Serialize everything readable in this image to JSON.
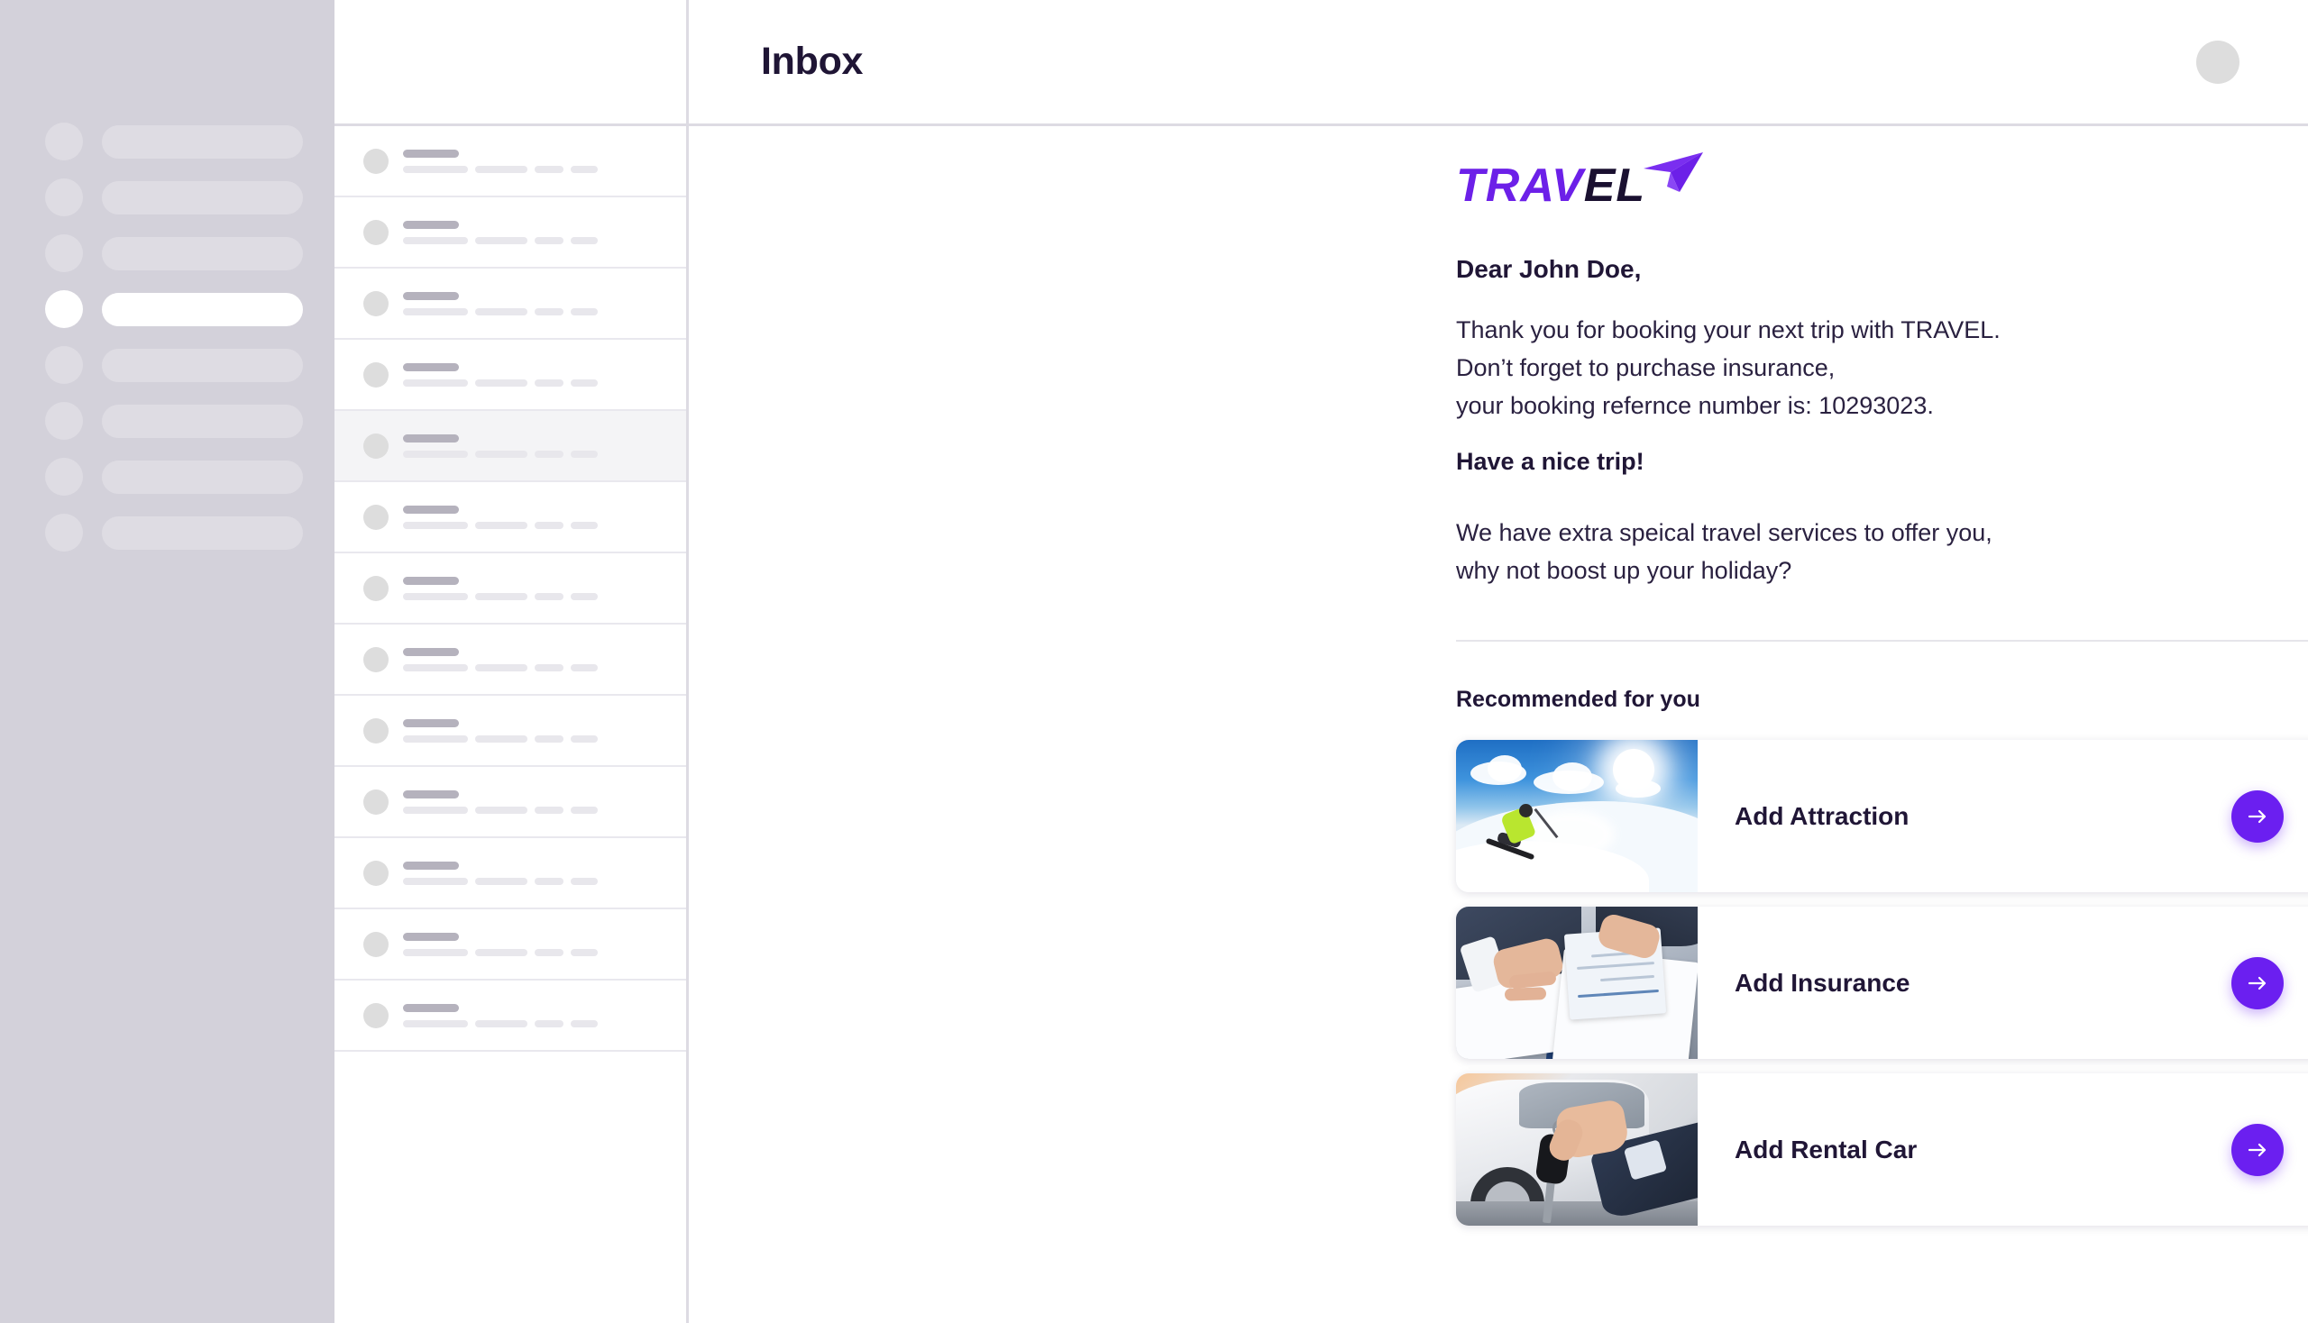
{
  "header": {
    "title": "Inbox",
    "avatar_icon": "user-avatar-placeholder"
  },
  "nav_rail": {
    "items": [
      {
        "state": "default"
      },
      {
        "state": "default"
      },
      {
        "state": "default"
      },
      {
        "state": "active"
      },
      {
        "state": "default"
      },
      {
        "state": "default"
      },
      {
        "state": "default"
      },
      {
        "state": "default"
      }
    ]
  },
  "message_list": {
    "rows": [
      {
        "selected": false
      },
      {
        "selected": false
      },
      {
        "selected": false
      },
      {
        "selected": false
      },
      {
        "selected": true
      },
      {
        "selected": false
      },
      {
        "selected": false
      },
      {
        "selected": false
      },
      {
        "selected": false
      },
      {
        "selected": false
      },
      {
        "selected": false
      },
      {
        "selected": false
      },
      {
        "selected": false
      }
    ]
  },
  "email": {
    "brand": {
      "name_primary": "TRAV",
      "name_secondary": "EL",
      "primary_color": "#6c20e8",
      "secondary_color": "#1a1030",
      "plane_icon": "paper-plane-icon"
    },
    "greeting": "Dear John Doe,",
    "paragraph_1": {
      "line_1": "Thank you for booking your next trip with TRAVEL.",
      "line_2": "Don’t forget to purchase insurance,",
      "line_3": "your booking refernce number is: 10293023."
    },
    "closing": "Have a nice trip!",
    "paragraph_2": {
      "line_1": "We have extra speical travel services to offer you,",
      "line_2": "why not boost up your holiday?"
    },
    "recommended_heading": "Recommended for you",
    "recommendations": [
      {
        "label": "Add Attraction",
        "thumb_icon": "ski-slope-photo",
        "cta_icon": "arrow-right-icon"
      },
      {
        "label": "Add Insurance",
        "thumb_icon": "insurance-paperwork-photo",
        "cta_icon": "arrow-right-icon"
      },
      {
        "label": "Add Rental Car",
        "thumb_icon": "car-keys-photo",
        "cta_icon": "arrow-right-icon"
      }
    ]
  },
  "theme": {
    "accent": "#6b1ff0",
    "text_dark": "#201636",
    "rail_bg": "#d3d1da",
    "skeleton": "#dedce3",
    "divider": "#dddbe3"
  }
}
